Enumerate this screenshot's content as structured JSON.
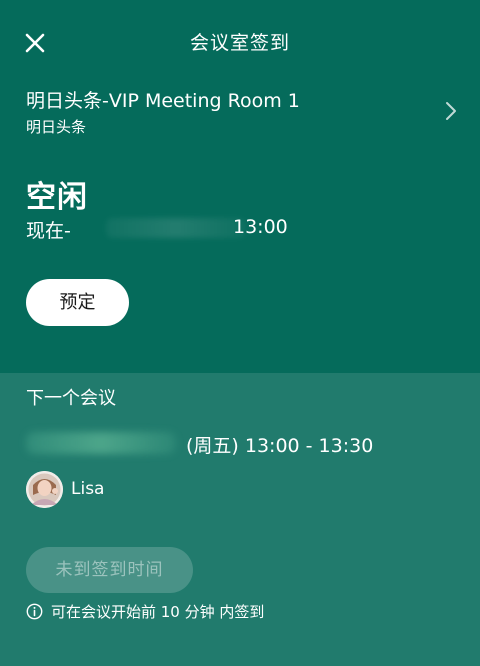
{
  "header": {
    "title": "会议室签到",
    "close_icon": "close-icon"
  },
  "room": {
    "name": "明日头条-VIP Meeting Room 1",
    "subtitle": "明日头条",
    "chevron_icon": "chevron-right-icon"
  },
  "availability": {
    "status": "空闲",
    "now_label": "现在-",
    "until_time": "13:00"
  },
  "actions": {
    "book_label": "预定"
  },
  "next_meeting": {
    "section_label": "下一个会议",
    "time": "(周五) 13:00 - 13:30",
    "attendee_name": "Lisa"
  },
  "checkin": {
    "button_label": "未到签到时间",
    "hint_text": "可在会议开始前 10 分钟 内签到",
    "info_icon": "info-icon"
  },
  "colors": {
    "top_background": "#056b5b",
    "bottom_background": "#217b6d",
    "button_background": "#ffffff"
  }
}
